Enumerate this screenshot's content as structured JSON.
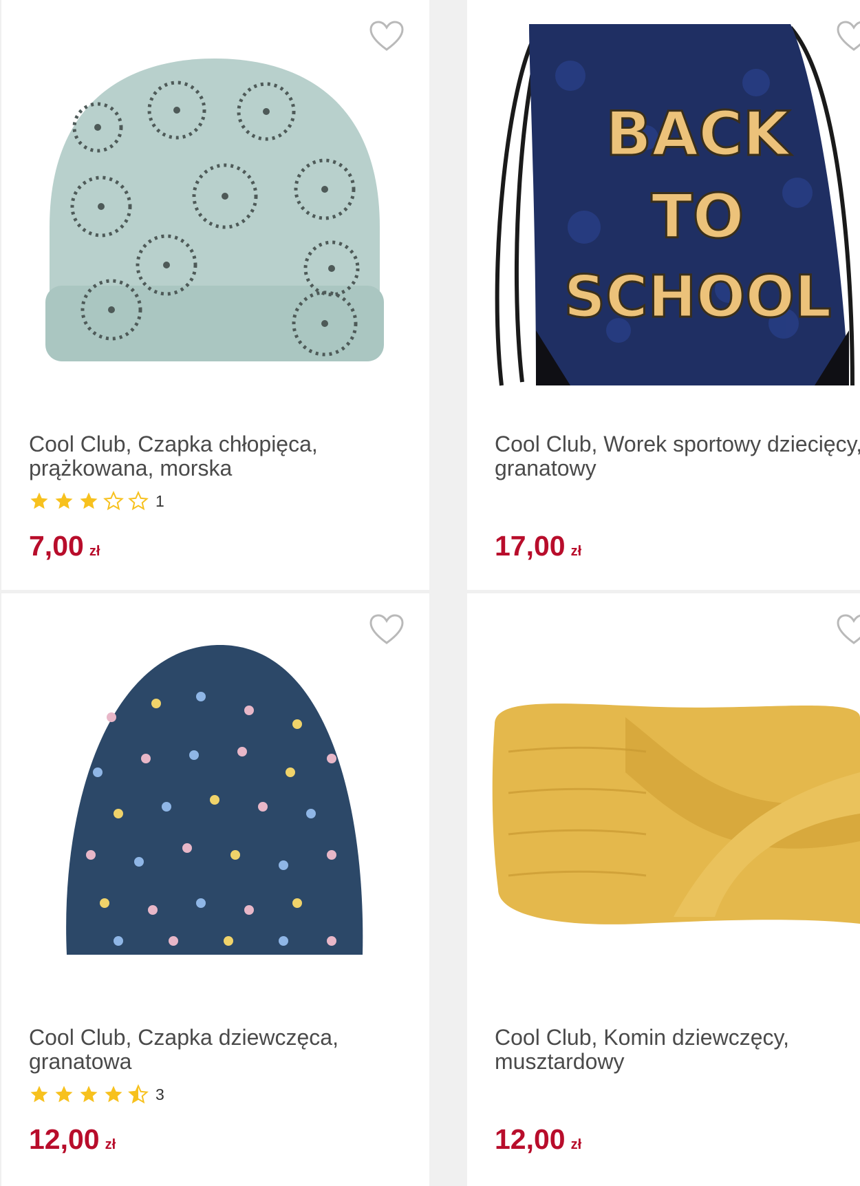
{
  "colors": {
    "price": "#b80d2b",
    "star": "#f7c11e",
    "title": "#4a4a4a"
  },
  "products": [
    {
      "title": "Cool Club, Czapka chłopięca, prążkowana, morska",
      "rating": 3,
      "rating_count": "1",
      "price": "7,00",
      "currency": "zł",
      "image_icon": "beanie-hat-image",
      "favorite_icon": "heart-outline-icon"
    },
    {
      "title": "Cool Club, Worek sportowy dziecięcy, granatowy",
      "price": "17,00",
      "currency": "zł",
      "image_icon": "drawstring-bag-image",
      "image_text": [
        "BACK",
        "TO",
        "SCHOOL"
      ],
      "favorite_icon": "heart-outline-icon"
    },
    {
      "title": "Cool Club, Czapka dziewczęca, granatowa",
      "rating": 4.5,
      "rating_count": "3",
      "price": "12,00",
      "currency": "zł",
      "image_icon": "dotted-hat-image",
      "favorite_icon": "heart-outline-icon"
    },
    {
      "title": "Cool Club, Komin dziewczęcy, musztardowy",
      "price": "12,00",
      "currency": "zł",
      "image_icon": "knit-headband-image",
      "favorite_icon": "heart-outline-icon"
    }
  ]
}
